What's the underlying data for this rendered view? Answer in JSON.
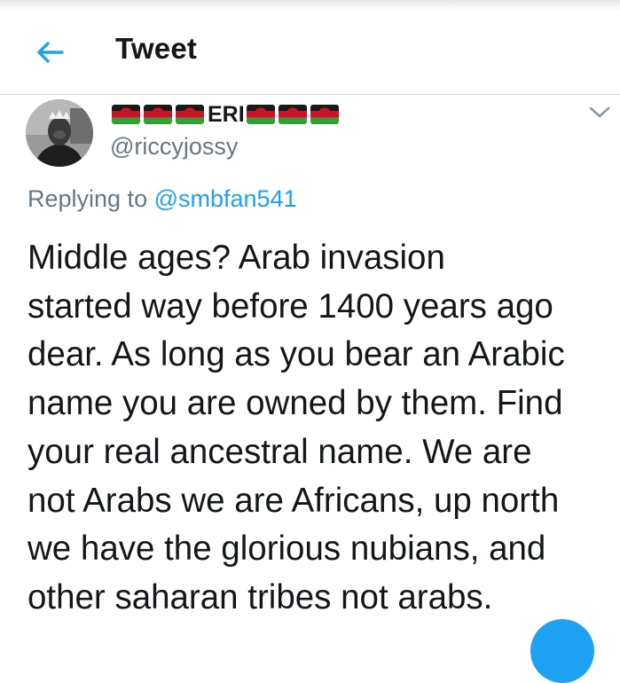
{
  "header": {
    "title": "Tweet",
    "back_icon": "back-arrow-icon"
  },
  "tweet": {
    "display_name_text": "ERI",
    "flag_icon": "malawi-flag-icon",
    "handle": "@riccyjossy",
    "replying_prefix": "Replying to",
    "replying_to": "@smbfan541",
    "text": "Middle ages?  Arab invasion\nstarted way before 1400 years ago\ndear. As long as you bear an Arabic\nname you are owned by them. Find\nyour real ancestral name. We are\nnot Arabs we are Africans, up north\nwe have the glorious nubians, and\nother saharan tribes not arabs."
  },
  "colors": {
    "accent": "#1da1f2",
    "secondary_text": "#657786",
    "primary_text": "#14171a",
    "divider": "#d7dde2"
  }
}
